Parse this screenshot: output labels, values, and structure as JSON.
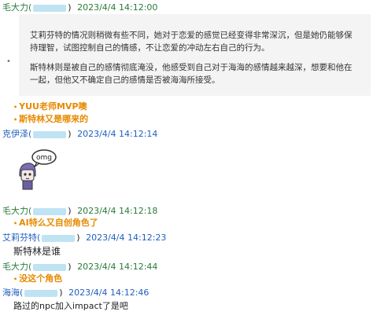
{
  "messages": [
    {
      "sender": "毛大力(",
      "time": "2023/4/4 14:12:00"
    },
    {
      "quote_p1": "艾莉芬特的情况则稍微有些不同，她对于恋爱的感觉已经变得非常深沉，但是她仍能够保持理智，试图控制自己的情感，不让恋爱的冲动左右自己的行为。",
      "quote_p2": "斯特林则是被自己的感情彻底淹没，他感受到自己对于海海的感情越来越深，想要和他在一起，但他又不确定自己的感情是否被海海所接受。"
    },
    {
      "line1": "YUU老师MVP噢",
      "line2": "斯特林又是哪来的"
    },
    {
      "sender": "克伊泽(",
      "time": "2023/4/4 14:12:14",
      "sticker_text": "omg"
    },
    {
      "sender": "毛大力(",
      "time": "2023/4/4 14:12:18",
      "text": "AI特么又自创角色了"
    },
    {
      "sender": "艾莉芬特(",
      "time": "2023/4/4 14:12:23",
      "text": "斯特林是谁"
    },
    {
      "sender": "毛大力(",
      "time": "2023/4/4 14:12:44",
      "text": "没这个角色"
    },
    {
      "sender": "海海(",
      "time": "2023/4/4 14:12:46",
      "text": "路过的npc加入impact了是吧"
    }
  ],
  "bullet": "•",
  "colors": {
    "green": "#2a7a3a",
    "blue": "#1f5fbf",
    "orange": "#e68a00",
    "quote_bg": "#f4f4f4",
    "redact": "#bfe3f3"
  }
}
